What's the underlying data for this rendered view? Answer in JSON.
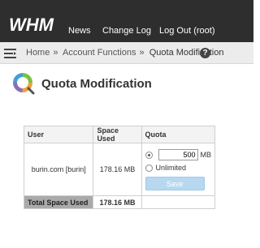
{
  "header": {
    "logo_text": "WHM",
    "nav": [
      "News",
      "Change Log",
      "Log Out (root)"
    ]
  },
  "breadcrumb": {
    "items": [
      "Home",
      "Account Functions",
      "Quota Modification"
    ],
    "separator": "»"
  },
  "page": {
    "title": "Quota Modification"
  },
  "table": {
    "headers": {
      "user": "User",
      "space_used": "Space Used",
      "quota": "Quota"
    },
    "row": {
      "user": "burin.com [burin]",
      "space_used": "178.16 MB"
    },
    "quota": {
      "selected": "limited",
      "value": "500",
      "unit": "MB",
      "unlimited_label": "Unlimited",
      "save_label": "Save"
    },
    "total": {
      "label": "Total Space Used",
      "value": "178.16 MB"
    }
  },
  "icons": {
    "menu": "hamburger-menu-icon",
    "help": "help-icon",
    "page": "quota-chart-icon"
  },
  "colors": {
    "topbar": "#2e2e2e",
    "save_button": "#b8d8f0",
    "total_label_bg": "#aaaaaa"
  }
}
